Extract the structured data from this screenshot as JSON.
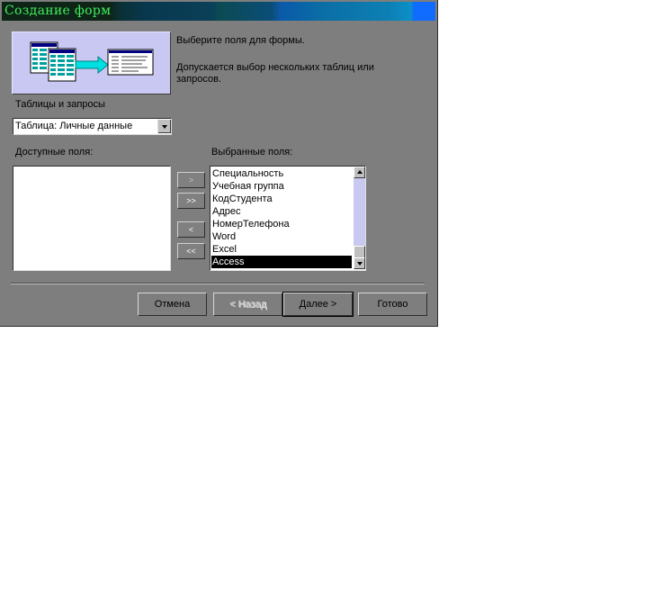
{
  "window": {
    "title": "Создание форм"
  },
  "banner": {
    "illustration": "tables-to-form-icon"
  },
  "instructions": {
    "line1": "Выберите поля для формы.",
    "line2a": "Допускается выбор нескольких таблиц или",
    "line2b": "запросов."
  },
  "tables": {
    "label": "Таблицы и запросы",
    "selected": "Таблица: Личные данные"
  },
  "available": {
    "label": "Доступные поля:",
    "items": []
  },
  "move_buttons": {
    "add_one": ">",
    "add_all": ">>",
    "remove_one": "<",
    "remove_all": "<<"
  },
  "selected_fields": {
    "label": "Выбранные поля:",
    "items": [
      "Специальность",
      "Учебная группа",
      "КодСтудента",
      "Адрес",
      "НомерТелефона",
      "Word",
      "Excel",
      "Access"
    ],
    "highlighted": "Access"
  },
  "buttons": {
    "cancel": "Отмена",
    "back": "< Назад",
    "next": "Далее >",
    "finish": "Готово"
  },
  "colors": {
    "dialog_bg": "#7e7e7e",
    "title_text": "#3ff05a",
    "banner_bg": "#c8c8f2",
    "scrollbar_track": "#c8c8f0"
  }
}
